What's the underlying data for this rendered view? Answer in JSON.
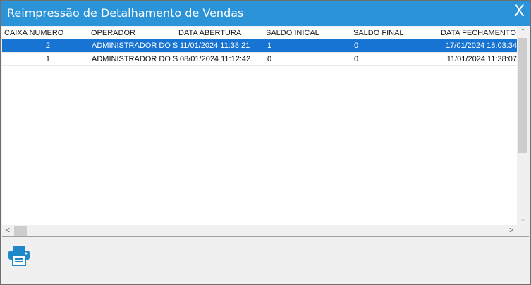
{
  "window": {
    "title": "Reimpressão de Detalhamento de Vendas",
    "close_label": "X"
  },
  "grid": {
    "columns": [
      "CAIXA NUMERO",
      "OPERADOR",
      "DATA ABERTURA",
      "SALDO INICAL",
      "SALDO FINAL",
      "DATA FECHAMENTO"
    ],
    "rows": [
      [
        "2",
        "ADMINISTRADOR DO SISTEMA",
        "11/01/2024 11:38:21",
        "1",
        "0",
        "17/01/2024 18:03:34"
      ],
      [
        "1",
        "ADMINISTRADOR DO SISTEMA",
        "08/01/2024 11:12:42",
        "0",
        "0",
        "11/01/2024 11:38:07"
      ]
    ],
    "selected_row": 0
  },
  "toolbar": {
    "print_icon": "printer-icon"
  },
  "colors": {
    "titlebar": "#2b93d8",
    "selection": "#1874d3",
    "print_icon": "#1e88c8"
  }
}
